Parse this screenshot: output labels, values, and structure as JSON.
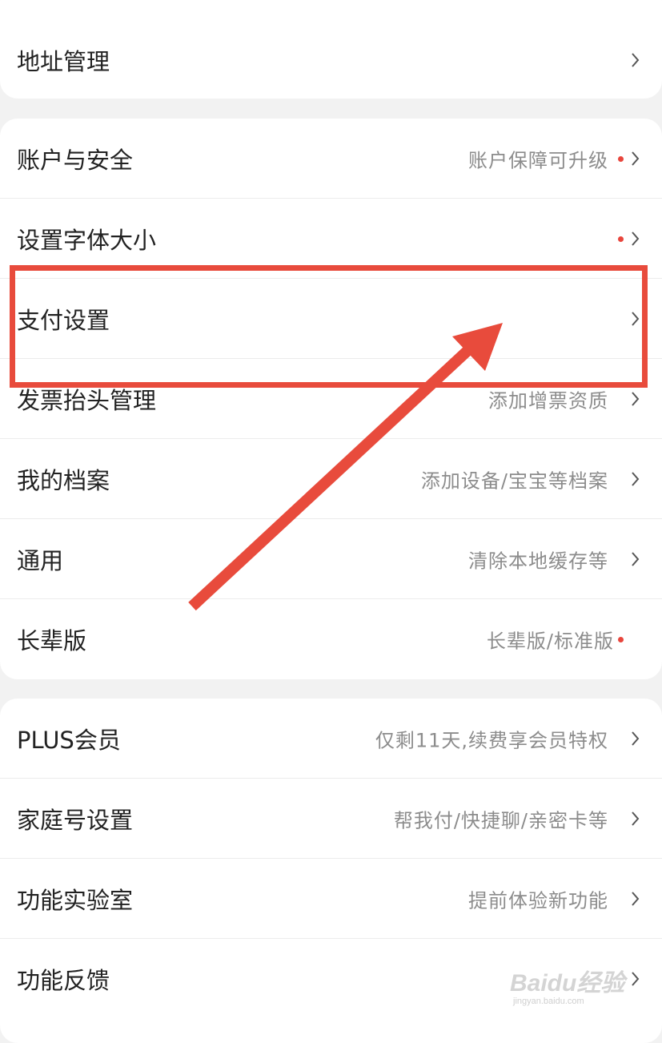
{
  "colors": {
    "background": "#f2f2f2",
    "card": "#ffffff",
    "label_text": "#222222",
    "value_text": "#8c8c8c",
    "badge_dot": "#e8453c",
    "annotation_red": "#e84b3c"
  },
  "group1": {
    "address": {
      "label": "地址管理"
    }
  },
  "group2": {
    "account": {
      "label": "账户与安全",
      "value": "账户保障可升级"
    },
    "font_size": {
      "label": "设置字体大小"
    },
    "payment": {
      "label": "支付设置"
    },
    "invoice": {
      "label": "发票抬头管理",
      "value": "添加增票资质"
    },
    "profile": {
      "label": "我的档案",
      "value": "添加设备/宝宝等档案"
    },
    "general": {
      "label": "通用",
      "value": "清除本地缓存等"
    },
    "elder": {
      "label": "长辈版",
      "value": "长辈版/标准版"
    }
  },
  "group3": {
    "plus": {
      "label": "PLUS会员",
      "value": "仅剩11天,续费享会员特权"
    },
    "family": {
      "label": "家庭号设置",
      "value": "帮我付/快捷聊/亲密卡等"
    },
    "lab": {
      "label": "功能实验室",
      "value": "提前体验新功能"
    },
    "feedback": {
      "label": "功能反馈"
    }
  },
  "icons": {
    "chevron": "chevron-right-icon",
    "badge": "red-dot-icon",
    "annotation_arrow": "arrow-icon"
  },
  "watermark": {
    "logo": "Baidu经验",
    "url": "jingyan.baidu.com"
  }
}
